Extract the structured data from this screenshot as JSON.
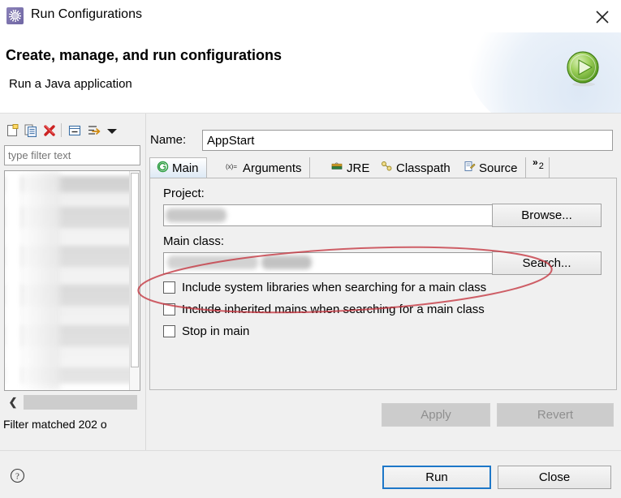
{
  "window": {
    "title": "Run Configurations",
    "app_icon": "gear-icon",
    "close_icon": "close-icon"
  },
  "header": {
    "title": "Create, manage, and run configurations",
    "subtitle": "Run a Java application",
    "run_icon": "run-play-icon"
  },
  "left_panel": {
    "toolbar": [
      {
        "name": "new-configuration-icon",
        "label": "New launch configuration"
      },
      {
        "name": "duplicate-configuration-icon",
        "label": "Duplicate"
      },
      {
        "name": "delete-configuration-icon",
        "label": "Delete"
      },
      {
        "name": "collapse-all-icon",
        "label": "Collapse All"
      },
      {
        "name": "filter-icon",
        "label": "Filter launch configurations"
      },
      {
        "name": "chevron-down-icon",
        "label": "View Menu"
      }
    ],
    "filter": {
      "value": "",
      "placeholder": "type filter text"
    },
    "tree_redacted": true,
    "scroll_left_icon": "chevron-left-icon",
    "status": "Filter matched 202 o"
  },
  "config": {
    "name_label": "Name:",
    "name_value": "AppStart",
    "tabs": [
      {
        "label": "Main",
        "icon": "main-class-icon",
        "selected": true
      },
      {
        "label": "Arguments",
        "icon": "arguments-icon",
        "selected": false
      },
      {
        "label": "JRE",
        "icon": "jre-icon",
        "selected": false
      },
      {
        "label": "Classpath",
        "icon": "classpath-icon",
        "selected": false
      },
      {
        "label": "Source",
        "icon": "source-icon",
        "selected": false
      }
    ],
    "tab_overflow": {
      "chevron": "»",
      "count": "2"
    },
    "project": {
      "label": "Project:",
      "value": "",
      "redacted": true,
      "browse_label": "Browse..."
    },
    "main_class": {
      "label": "Main class:",
      "value": "",
      "redacted": true,
      "search_label": "Search..."
    },
    "checkboxes": [
      {
        "label": "Include system libraries when searching for a main class",
        "checked": false
      },
      {
        "label": "Include inherited mains when searching for a main class",
        "checked": false
      },
      {
        "label": "Stop in main",
        "checked": false
      }
    ],
    "apply_label": "Apply",
    "apply_enabled": false,
    "revert_label": "Revert",
    "revert_enabled": false
  },
  "footer": {
    "help_icon": "help-icon",
    "run_label": "Run",
    "close_label": "Close"
  },
  "annotation": {
    "type": "ellipse",
    "color": "#c4353f",
    "target": "main-class-field-and-search-button"
  },
  "colors": {
    "accent_blue": "#1d77c8",
    "annotation_red": "#c4353f",
    "run_green": "#6aad2e",
    "dialog_bg": "#f0f0f0"
  }
}
